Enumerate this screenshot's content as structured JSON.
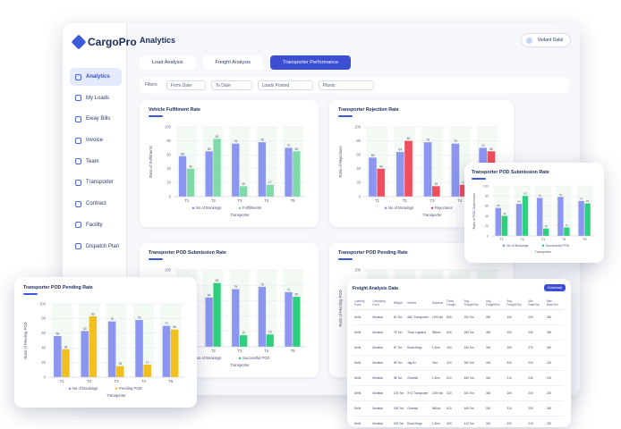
{
  "app": {
    "logo_text": "CargoPro",
    "page_title": "Analytics",
    "user_name": "Vedant Dalal",
    "colors": {
      "primary": "#3b4fd0",
      "blue_bar": "#8c96f0",
      "green_bar": "#7fd9a8",
      "red_bar": "#f04e5e",
      "dark_green_bar": "#2ecf7e",
      "yellow_bar": "#f2c01e"
    }
  },
  "sidebar": {
    "items": [
      {
        "label": "Analytics",
        "icon": "chart-line-icon",
        "active": true
      },
      {
        "label": "My Loads",
        "icon": "box-icon"
      },
      {
        "label": "Eway Bills",
        "icon": "document-icon"
      },
      {
        "label": "Invoice",
        "icon": "invoice-icon"
      },
      {
        "label": "Team",
        "icon": "team-icon"
      },
      {
        "label": "Transporter",
        "icon": "truck-icon"
      },
      {
        "label": "Contract",
        "icon": "contract-icon"
      },
      {
        "label": "Facility",
        "icon": "location-pin-icon"
      },
      {
        "label": "Dispatch Plan",
        "icon": "route-icon"
      }
    ]
  },
  "tabs": [
    {
      "label": "Load Analysis"
    },
    {
      "label": "Freight Analysis"
    },
    {
      "label": "Transporter Performance",
      "active": true
    }
  ],
  "filters": {
    "label": "Filters",
    "boxes": [
      "From Date",
      "To Date",
      "Loads Posted",
      "Plants"
    ]
  },
  "chart_data": [
    {
      "id": "vehicle-fulfilment",
      "type": "bar",
      "title": "Vehicle Fulfilment Rate",
      "ylabel": "Ratio of Fulfilments",
      "xlabel": "Transporter",
      "categories": [
        "T1",
        "T2",
        "T3",
        "T4",
        "T5"
      ],
      "ylim": [
        0,
        100
      ],
      "yticks": [
        0,
        20,
        40,
        60,
        80,
        100
      ],
      "series": [
        {
          "name": "No of Bookings",
          "values": [
            58,
            65,
            76,
            78,
            70
          ],
          "color": "#8c96f0"
        },
        {
          "name": "Fulfillments",
          "values": [
            40,
            83,
            15,
            17,
            65
          ],
          "color": "#7fd9a8"
        }
      ]
    },
    {
      "id": "transporter-rejection",
      "type": "bar",
      "title": "Transporter Rejection Rate",
      "ylabel": "Ratio of Rejections",
      "xlabel": "Transporter",
      "categories": [
        "T1",
        "T2",
        "T3",
        "T4",
        "T5"
      ],
      "ylim": [
        0,
        100
      ],
      "yticks": [
        0,
        20,
        40,
        60,
        80,
        100
      ],
      "series": [
        {
          "name": "No of Bookings",
          "values": [
            56,
            64,
            78,
            76,
            70
          ],
          "color": "#8c96f0"
        },
        {
          "name": "Rejections",
          "values": [
            40,
            80,
            15,
            17,
            65
          ],
          "color": "#f04e5e"
        }
      ]
    },
    {
      "id": "pod-submission-main",
      "type": "bar",
      "title": "Transporter POD Submission Rate",
      "ylabel": "",
      "xlabel": "Transporter",
      "categories": [
        "T1",
        "T2",
        "T3",
        "T4",
        "T5"
      ],
      "ylim": [
        0,
        100
      ],
      "yticks": [
        0,
        20,
        40,
        60,
        80,
        100
      ],
      "series": [
        {
          "name": "No of Bookings",
          "values": [
            56,
            64,
            75,
            78,
            71
          ],
          "color": "#8c96f0"
        },
        {
          "name": "Successful POD",
          "values": [
            40,
            83,
            15,
            16,
            65
          ],
          "color": "#2ecf7e"
        }
      ]
    },
    {
      "id": "pod-submission-float",
      "type": "bar",
      "title": "Transporter POD Submission Rate",
      "ylabel": "Ratio of POD Submission",
      "xlabel": "Transporter",
      "categories": [
        "T1",
        "T2",
        "T3",
        "T4",
        "T5"
      ],
      "ylim": [
        0,
        100
      ],
      "yticks": [
        0,
        20,
        40,
        60,
        80,
        100
      ],
      "series": [
        {
          "name": "No of Bookings",
          "values": [
            56,
            64,
            76,
            78,
            70
          ],
          "color": "#8c96f0"
        },
        {
          "name": "Successful POD",
          "values": [
            40,
            80,
            15,
            17,
            65
          ],
          "color": "#2ecf7e"
        }
      ]
    },
    {
      "id": "pod-pending-float",
      "type": "bar",
      "title": "Transporter POD Pending Rate",
      "ylabel": "Ratio of Pending POD",
      "xlabel": "Transporter",
      "categories": [
        "T1",
        "T2",
        "T3",
        "T4",
        "T5"
      ],
      "ylim": [
        0,
        100
      ],
      "yticks": [
        0,
        20,
        40,
        60,
        80,
        100
      ],
      "series": [
        {
          "name": "No of Bookings",
          "values": [
            56,
            63,
            76,
            78,
            70
          ],
          "color": "#8c96f0"
        },
        {
          "name": "Pending POD",
          "values": [
            38,
            83,
            15,
            17,
            65
          ],
          "color": "#f2c01e"
        }
      ]
    },
    {
      "id": "pod-pending-main",
      "type": "bar",
      "title": "Transporter POD Pending Rate",
      "ylabel": "Ratio of Pending POD",
      "xlabel": "",
      "categories": [],
      "ylim": [
        0,
        100
      ],
      "yticks": [
        0,
        20,
        40,
        60,
        80,
        100
      ],
      "series": []
    }
  ],
  "table": {
    "title": "Freight Analysis Data",
    "button": "Download",
    "columns": [
      "Loading Point",
      "Unloading Point",
      "Weight",
      "Vehicle",
      "Distance",
      "Fixed Freight",
      "Avg. Freight/Ton",
      "Avg Freight/Km",
      "Avg Freight/Ton",
      "Min Rate/Ton",
      "Max Rate/Ton"
    ],
    "rows": [
      [
        "Delhi",
        "Mumbai",
        "50 Ton",
        "ABC Transporter",
        "1200 km",
        "800",
        "200 Ton",
        "350",
        "150",
        "200",
        "250"
      ],
      [
        "Delhi",
        "Mumbai",
        "78 Ton",
        "Truck Logistics",
        "960km",
        "600",
        "250 Ton",
        "450",
        "200",
        "240",
        "250"
      ],
      [
        "Delhi",
        "Mumbai",
        "87 Ton",
        "Road Kings",
        "1.2km",
        "400",
        "340 Ton",
        "340",
        "150",
        "270",
        "240"
      ],
      [
        "Delhi",
        "Mumbai",
        "98 Ton",
        "Jag Ex",
        "7km",
        "420",
        "260 Ton",
        "430",
        "330",
        "220",
        "210"
      ],
      [
        "Delhi",
        "Mumbai",
        "98 Ton",
        "Chamtal",
        "1.3km",
        "610",
        "460 Ton",
        "340",
        "210",
        "240",
        "210"
      ],
      [
        "Delhi",
        "Mumbai",
        "100 Ton",
        "XYZ Transporter",
        "1000 km",
        "320",
        "340 Ton",
        "300",
        "160",
        "200",
        "220"
      ],
      [
        "Delhi",
        "Mumbai",
        "150 Ton",
        "Chamtal",
        "560km",
        "610",
        "460 Ton",
        "240",
        "310",
        "250",
        "260"
      ],
      [
        "Delhi",
        "Mumbai",
        "150 Ton",
        "Road Kings",
        "1.3km",
        "400",
        "410 Ton",
        "310",
        "220",
        "210",
        "220"
      ],
      [
        "Delhi",
        "Mumbai",
        "98 Ton",
        "Chamtal",
        "1.8km",
        "420",
        "340 Ton",
        "240",
        "310",
        "200",
        "220"
      ]
    ]
  }
}
